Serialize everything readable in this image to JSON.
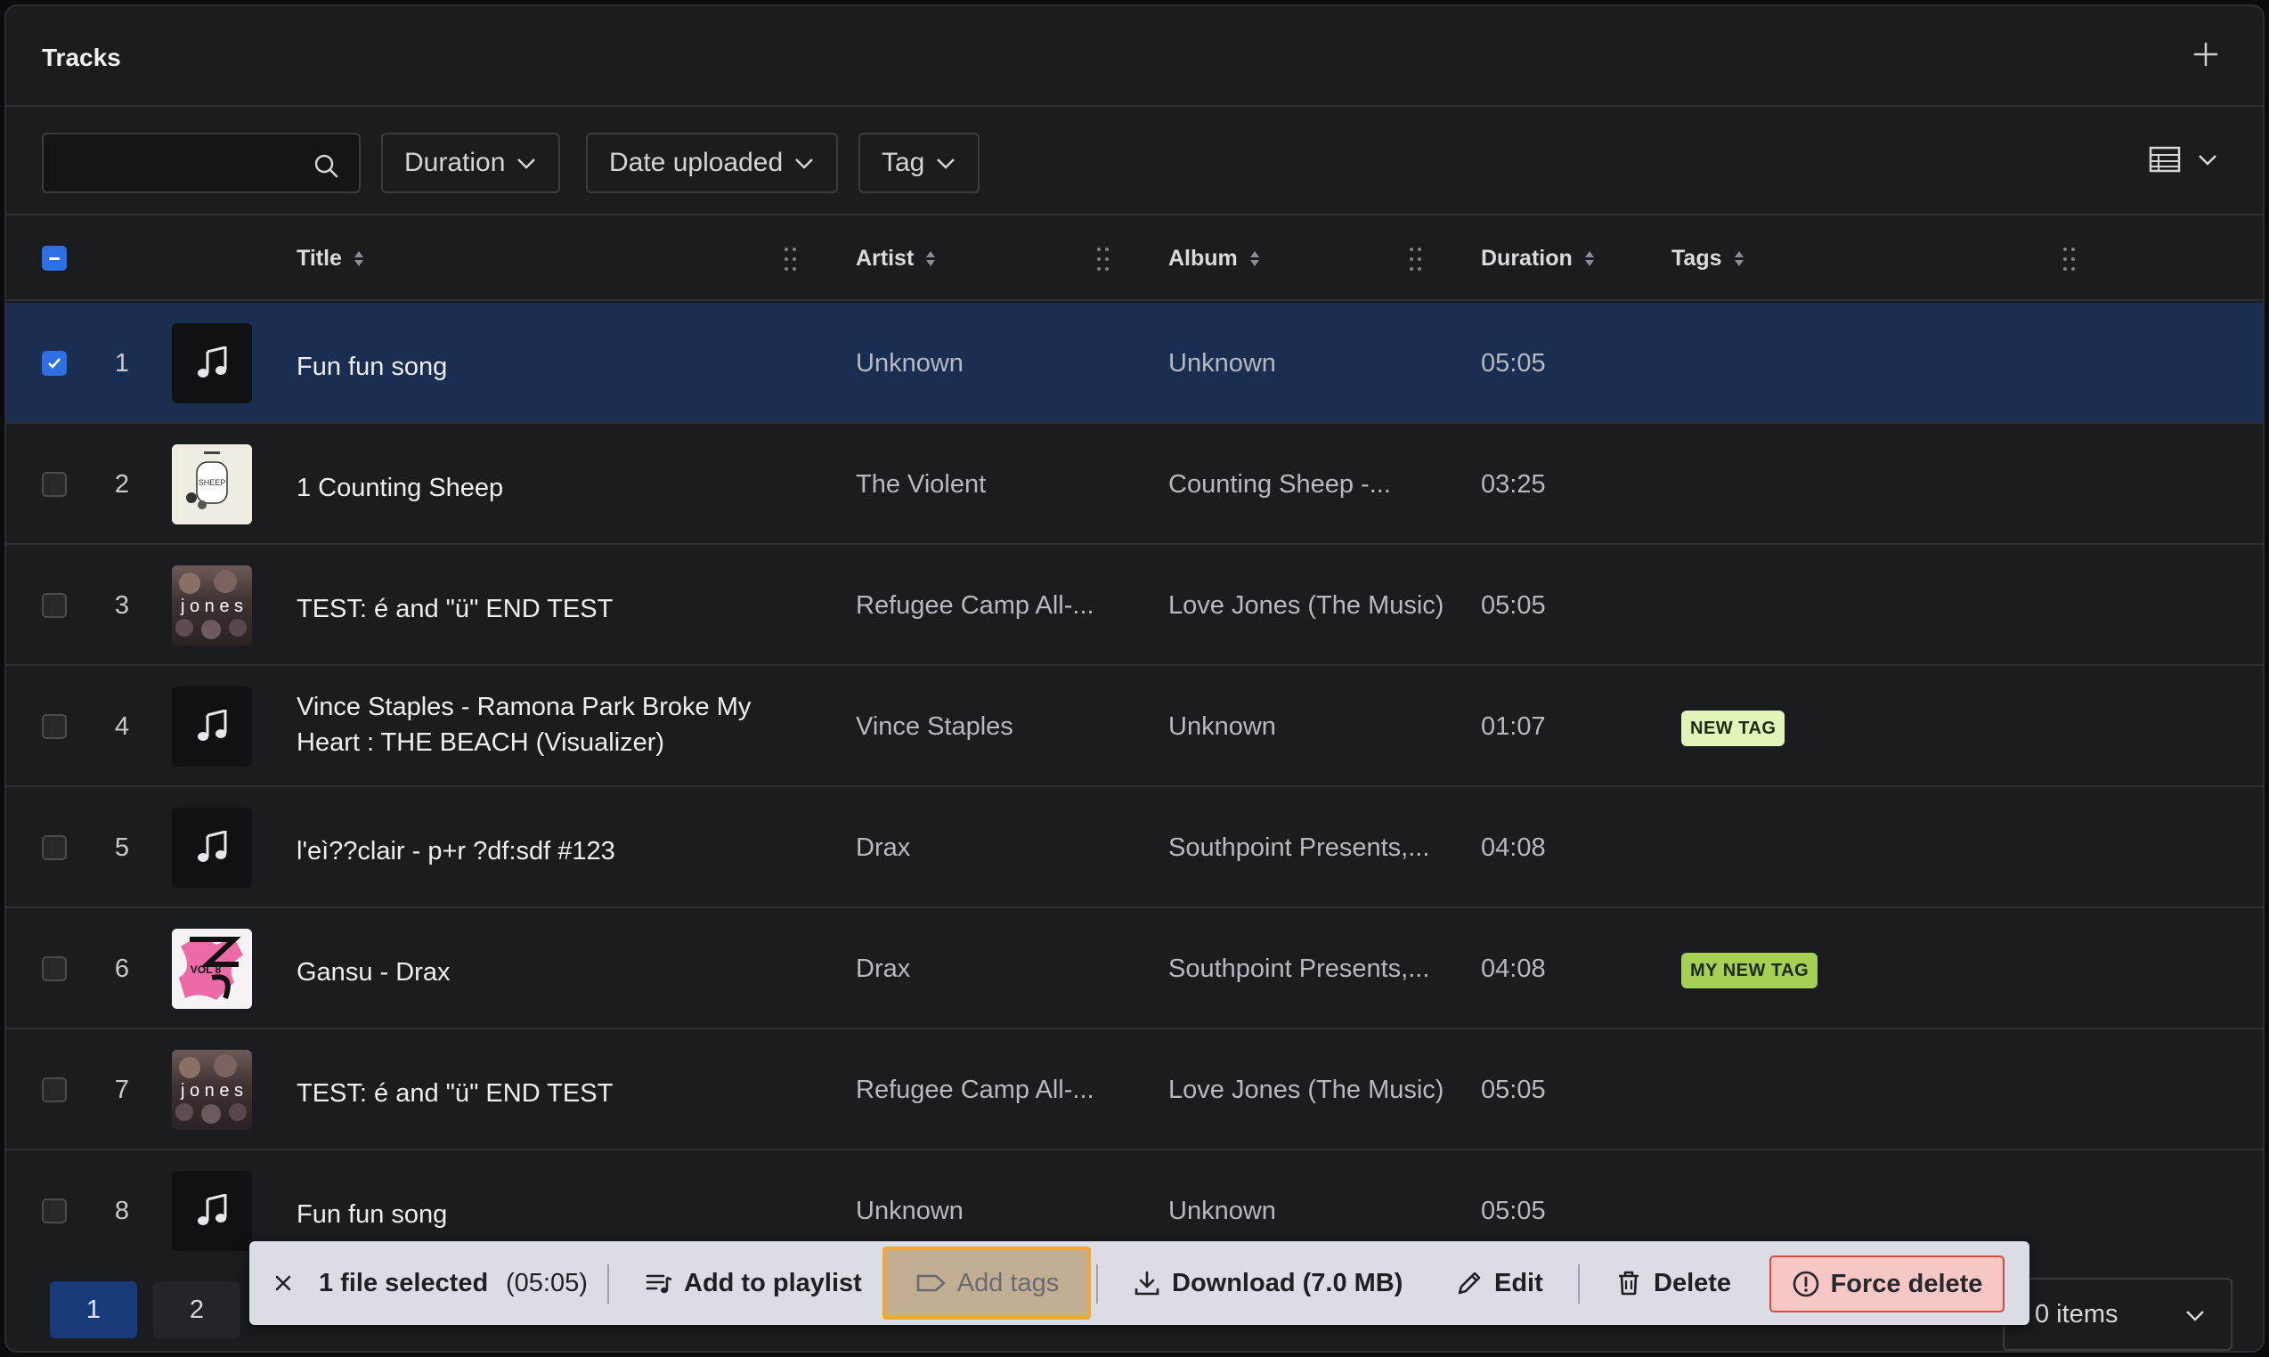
{
  "header": {
    "title": "Tracks",
    "add_icon": "plus-icon"
  },
  "toolbar": {
    "search_value": "",
    "search_icon": "search-icon",
    "filters": [
      {
        "label": "Duration"
      },
      {
        "label": "Date uploaded"
      },
      {
        "label": "Tag"
      }
    ],
    "view_icon": "table-view-icon"
  },
  "columns": {
    "title": "Title",
    "artist": "Artist",
    "album": "Album",
    "duration": "Duration",
    "tags": "Tags"
  },
  "rows": [
    {
      "num": "1",
      "title": "Fun fun song",
      "artist": "Unknown",
      "album": "Unknown",
      "duration": "05:05",
      "tag": "",
      "selected": true,
      "thumb": "music-note-icon"
    },
    {
      "num": "2",
      "title": "1 Counting Sheep",
      "artist": "The Violent",
      "album": "Counting Sheep -...",
      "duration": "03:25",
      "tag": "",
      "selected": false,
      "thumb": "album-art"
    },
    {
      "num": "3",
      "title": "TEST: é and \"ü\" END TEST",
      "artist": "Refugee Camp All-...",
      "album": "Love Jones (The Music)",
      "duration": "05:05",
      "tag": "",
      "selected": false,
      "thumb": "album-art"
    },
    {
      "num": "4",
      "title": "Vince Staples - Ramona Park Broke My Heart : THE BEACH (Visualizer)",
      "artist": "Vince Staples",
      "album": "Unknown",
      "duration": "01:07",
      "tag": "NEW TAG",
      "tag_color": "#e1f5b8",
      "selected": false,
      "thumb": "music-note-icon"
    },
    {
      "num": "5",
      "title": "l'eì??clair - p+r ?df:sdf #123",
      "artist": "Drax",
      "album": "Southpoint Presents,...",
      "duration": "04:08",
      "tag": "",
      "selected": false,
      "thumb": "music-note-icon"
    },
    {
      "num": "6",
      "title": "Gansu - Drax",
      "artist": "Drax",
      "album": "Southpoint Presents,...",
      "duration": "04:08",
      "tag": "MY NEW TAG",
      "tag_color": "#a6cf56",
      "selected": false,
      "thumb": "album-art"
    },
    {
      "num": "7",
      "title": "TEST: é and \"ü\" END TEST",
      "artist": "Refugee Camp All-...",
      "album": "Love Jones (The Music)",
      "duration": "05:05",
      "tag": "",
      "selected": false,
      "thumb": "album-art"
    },
    {
      "num": "8",
      "title": "Fun fun song",
      "artist": "Unknown",
      "album": "Unknown",
      "duration": "05:05",
      "tag": "",
      "selected": false,
      "thumb": "music-note-icon"
    }
  ],
  "album_art_text": {
    "sheep": "SHEEP",
    "jones": "j o n e s",
    "gansu": "VOL 8"
  },
  "pagination": {
    "pages": [
      "1",
      "2"
    ],
    "active": "1",
    "items_label": "0 items"
  },
  "action_bar": {
    "selected_label": "1 file selected",
    "selected_duration": "(05:05)",
    "add_to_playlist": "Add to playlist",
    "add_tags": "Add tags",
    "download": "Download (7.0 MB)",
    "edit": "Edit",
    "delete": "Delete",
    "force_delete": "Force delete"
  },
  "colors": {
    "accent": "#2f6fe4",
    "selected_row": "#1a2e52",
    "highlight_border": "#f0a63c",
    "danger": "#d84a41"
  }
}
